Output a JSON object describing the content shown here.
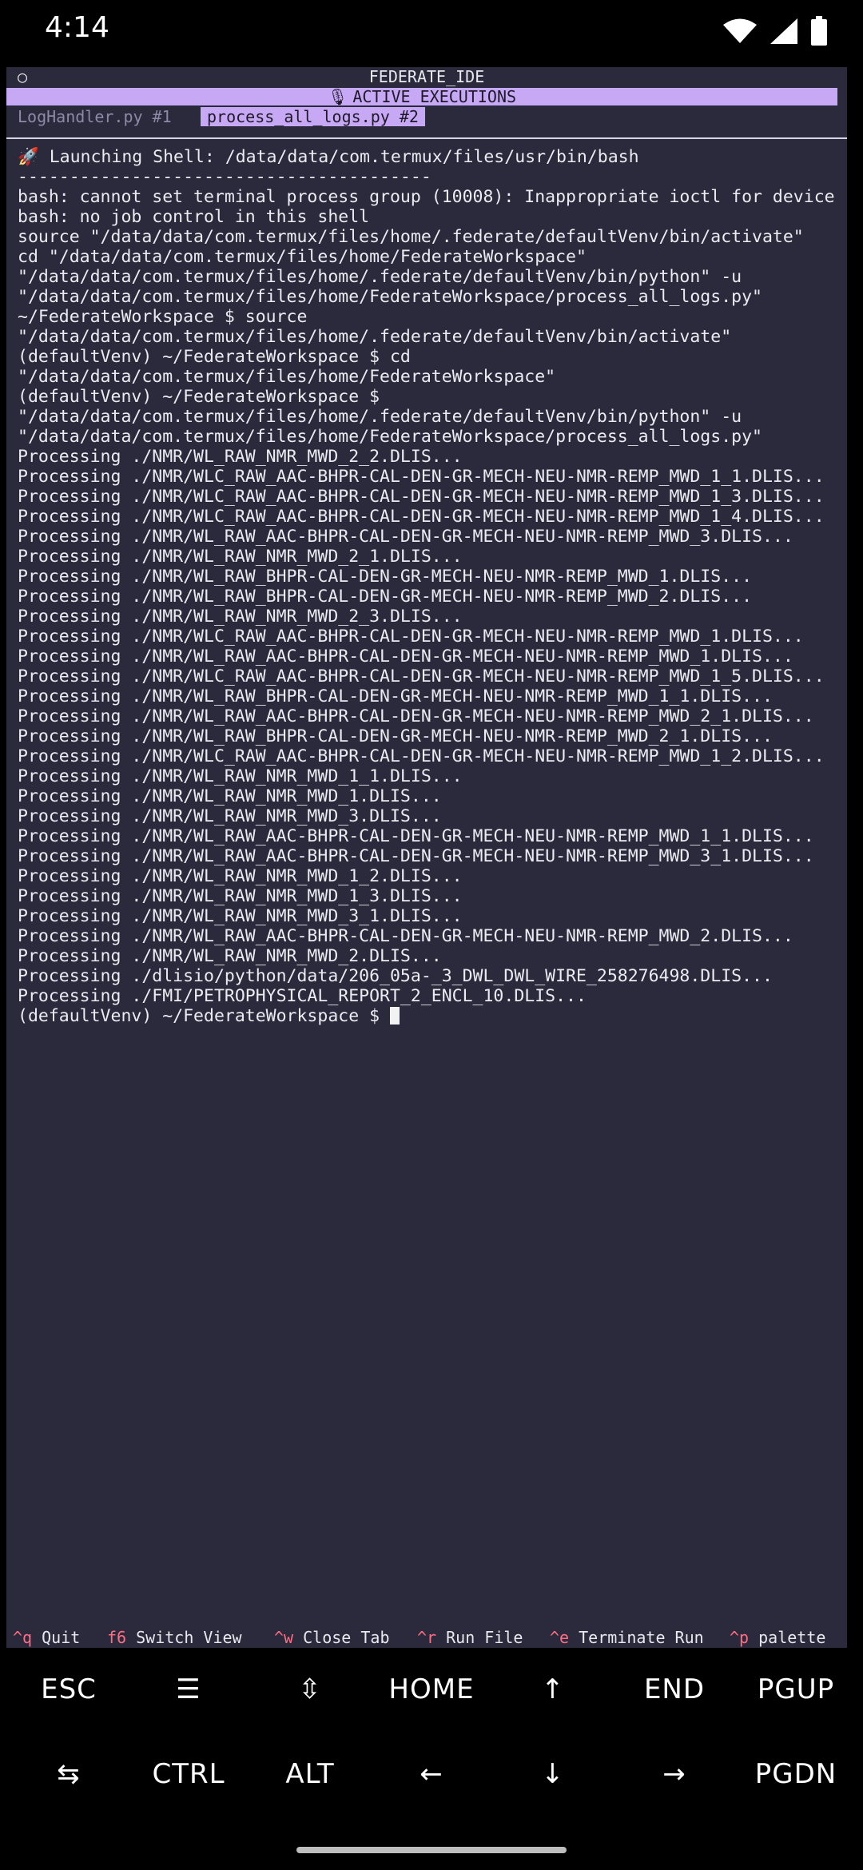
{
  "status_bar": {
    "time": "4:14"
  },
  "terminal": {
    "title_marker": "○",
    "title": "FEDERATE_IDE",
    "executions_title": "ACTIVE EXECUTIONS",
    "tabs": [
      {
        "label": "LogHandler.py #1"
      },
      {
        "label": "process_all_logs.py #2"
      }
    ],
    "output_lines": [
      "🚀 Launching Shell: /data/data/com.termux/files/usr/bin/bash",
      "----------------------------------------",
      "bash: cannot set terminal process group (10008): Inappropriate ioctl for device",
      "bash: no job control in this shell",
      "source \"/data/data/com.termux/files/home/.federate/defaultVenv/bin/activate\"",
      "cd \"/data/data/com.termux/files/home/FederateWorkspace\"",
      "\"/data/data/com.termux/files/home/.federate/defaultVenv/bin/python\" -u",
      "\"/data/data/com.termux/files/home/FederateWorkspace/process_all_logs.py\"",
      "~/FederateWorkspace $ source",
      "\"/data/data/com.termux/files/home/.federate/defaultVenv/bin/activate\"",
      "(defaultVenv) ~/FederateWorkspace $ cd",
      "\"/data/data/com.termux/files/home/FederateWorkspace\"",
      "(defaultVenv) ~/FederateWorkspace $",
      "\"/data/data/com.termux/files/home/.federate/defaultVenv/bin/python\" -u",
      "\"/data/data/com.termux/files/home/FederateWorkspace/process_all_logs.py\"",
      "Processing ./NMR/WL_RAW_NMR_MWD_2_2.DLIS...",
      "Processing ./NMR/WLC_RAW_AAC-BHPR-CAL-DEN-GR-MECH-NEU-NMR-REMP_MWD_1_1.DLIS...",
      "Processing ./NMR/WLC_RAW_AAC-BHPR-CAL-DEN-GR-MECH-NEU-NMR-REMP_MWD_1_3.DLIS...",
      "Processing ./NMR/WLC_RAW_AAC-BHPR-CAL-DEN-GR-MECH-NEU-NMR-REMP_MWD_1_4.DLIS...",
      "Processing ./NMR/WL_RAW_AAC-BHPR-CAL-DEN-GR-MECH-NEU-NMR-REMP_MWD_3.DLIS...",
      "Processing ./NMR/WL_RAW_NMR_MWD_2_1.DLIS...",
      "Processing ./NMR/WL_RAW_BHPR-CAL-DEN-GR-MECH-NEU-NMR-REMP_MWD_1.DLIS...",
      "Processing ./NMR/WL_RAW_BHPR-CAL-DEN-GR-MECH-NEU-NMR-REMP_MWD_2.DLIS...",
      "Processing ./NMR/WL_RAW_NMR_MWD_2_3.DLIS...",
      "Processing ./NMR/WLC_RAW_AAC-BHPR-CAL-DEN-GR-MECH-NEU-NMR-REMP_MWD_1.DLIS...",
      "Processing ./NMR/WL_RAW_AAC-BHPR-CAL-DEN-GR-MECH-NEU-NMR-REMP_MWD_1.DLIS...",
      "Processing ./NMR/WLC_RAW_AAC-BHPR-CAL-DEN-GR-MECH-NEU-NMR-REMP_MWD_1_5.DLIS...",
      "Processing ./NMR/WL_RAW_BHPR-CAL-DEN-GR-MECH-NEU-NMR-REMP_MWD_1_1.DLIS...",
      "Processing ./NMR/WL_RAW_AAC-BHPR-CAL-DEN-GR-MECH-NEU-NMR-REMP_MWD_2_1.DLIS...",
      "Processing ./NMR/WL_RAW_BHPR-CAL-DEN-GR-MECH-NEU-NMR-REMP_MWD_2_1.DLIS...",
      "Processing ./NMR/WLC_RAW_AAC-BHPR-CAL-DEN-GR-MECH-NEU-NMR-REMP_MWD_1_2.DLIS...",
      "Processing ./NMR/WL_RAW_NMR_MWD_1_1.DLIS...",
      "Processing ./NMR/WL_RAW_NMR_MWD_1.DLIS...",
      "Processing ./NMR/WL_RAW_NMR_MWD_3.DLIS...",
      "Processing ./NMR/WL_RAW_AAC-BHPR-CAL-DEN-GR-MECH-NEU-NMR-REMP_MWD_1_1.DLIS...",
      "Processing ./NMR/WL_RAW_AAC-BHPR-CAL-DEN-GR-MECH-NEU-NMR-REMP_MWD_3_1.DLIS...",
      "Processing ./NMR/WL_RAW_NMR_MWD_1_2.DLIS...",
      "Processing ./NMR/WL_RAW_NMR_MWD_1_3.DLIS...",
      "Processing ./NMR/WL_RAW_NMR_MWD_3_1.DLIS...",
      "Processing ./NMR/WL_RAW_AAC-BHPR-CAL-DEN-GR-MECH-NEU-NMR-REMP_MWD_2.DLIS...",
      "Processing ./NMR/WL_RAW_NMR_MWD_2.DLIS...",
      "Processing ./dlisio/python/data/206_05a-_3_DWL_DWL_WIRE_258276498.DLIS...",
      "Processing ./FMI/PETROPHYSICAL_REPORT_2_ENCL_10.DLIS..."
    ],
    "prompt": "(defaultVenv) ~/FederateWorkspace $ ",
    "shortcuts": [
      {
        "key": "^q",
        "label": "Quit"
      },
      {
        "key": "f6",
        "label": "Switch View"
      },
      {
        "key": "^w",
        "label": "Close Tab"
      },
      {
        "key": "^r",
        "label": "Run File"
      },
      {
        "key": "^e",
        "label": "Terminate Run"
      },
      {
        "key": "^p",
        "label": "palette"
      }
    ]
  },
  "extra_keys": {
    "row1": [
      "ESC",
      "☰",
      "⇳",
      "HOME",
      "↑",
      "END",
      "PGUP"
    ],
    "row2": [
      "⇆",
      "CTRL",
      "ALT",
      "←",
      "↓",
      "→",
      "PGDN"
    ]
  },
  "colors": {
    "terminal_bg": "#2b2a3c",
    "accent_purple": "#c7a8f5",
    "shortcut_key": "#ff6d83"
  }
}
